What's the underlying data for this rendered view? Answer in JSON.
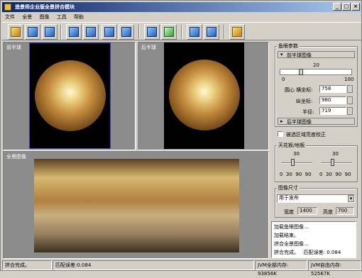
{
  "window": {
    "title": "造景师企业版全景拼合模块"
  },
  "menu": [
    "文件",
    "全景",
    "图像",
    "工具",
    "帮助"
  ],
  "left_panels": {
    "front": {
      "label": "前半球"
    },
    "back": {
      "label": "后半球"
    },
    "pano": {
      "label": "全景图像"
    }
  },
  "right": {
    "fisheye_group": "鱼眼参数",
    "front_section": "前半球图像",
    "slider_value": "20",
    "slider_min": "0",
    "slider_max": "100",
    "center_x_label": "圆心 横坐标:",
    "center_x_value": "758",
    "center_y_label": "纵坐标:",
    "center_y_value": "980",
    "radius_label": "半径:",
    "radius_value": "719",
    "back_section": "后半球图像",
    "checkbox_label": "被选区域亮度校正",
    "sky_group": "天花板/地板",
    "sky_left_val": "30",
    "sky_right_val": "30",
    "sky_left_ticks": "0  30  90  90",
    "sky_right_ticks": "0  30  90  90",
    "size_group": "图像尺寸",
    "size_select": "用于发布",
    "width_label": "宽度",
    "width_value": "1400",
    "height_label": "高度",
    "height_value": "700"
  },
  "log": [
    "加载鱼眼图像...",
    "加载结束。",
    "拼合全景图像...",
    "拼合完成。   匹配误差: 0.084"
  ],
  "status": {
    "left": "拼合完成。",
    "error": "匹配误差:0.084",
    "jvm_total": "JVM全部内存: 93856K",
    "jvm_free": "JVM自由内存: 52567K"
  }
}
